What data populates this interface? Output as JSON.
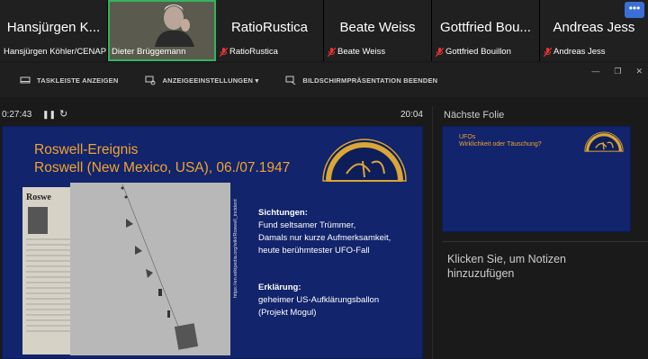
{
  "participants": [
    {
      "big": "Hansjürgen K...",
      "small": "Hansjürgen Köhler/CENAP",
      "muted": false
    },
    {
      "big": "",
      "small": "Dieter Brüggemann",
      "muted": false,
      "active": true
    },
    {
      "big": "RatioRustica",
      "small": "RatioRustica",
      "muted": true
    },
    {
      "big": "Beate Weiss",
      "small": "Beate Weiss",
      "muted": true
    },
    {
      "big": "Gottfried Bou...",
      "small": "Gottfried Bouillon",
      "muted": true
    },
    {
      "big": "Andreas Jess",
      "small": "Andreas Jess",
      "muted": true
    }
  ],
  "more_label": "•••",
  "toolbar": {
    "show_taskbar": "TASKLEISTE ANZEIGEN",
    "display_settings": "ANZEIGEEINSTELLUNGEN ▾",
    "end_presentation": "BILDSCHIRMPRÄSENTATION BEENDEN"
  },
  "window": {
    "minimize": "—",
    "restore": "❐",
    "close": "✕"
  },
  "player": {
    "elapsed": "0:27:43",
    "pause": "❚❚",
    "reload": "↻",
    "clock": "20:04"
  },
  "slide": {
    "title1": "Roswell-Ereignis",
    "title2": "Roswell (New Mexico, USA), 06./07.1947",
    "h1": "Sichtungen:",
    "l1": "Fund seltsamer Trümmer,",
    "l2": "Damals nur kurze Aufmerksamkeit,",
    "l3": "heute berühmtester UFO-Fall",
    "h2": "Erklärung:",
    "l4": "geheimer US-Aufklärungsballon",
    "l5": "(Projekt Mogul)",
    "url": "https://en.wikipedia.org/wiki/Roswell_incident",
    "logo_text": "ARBEITSKREIS HUMBOLDT BEZOGEN UFO"
  },
  "right": {
    "next_label": "Nächste Folie",
    "next_t1": "UFOs",
    "next_t2": "Wirklichkeit oder Täuschung?",
    "notes": "Klicken Sie, um Notizen hinzuzufügen"
  }
}
